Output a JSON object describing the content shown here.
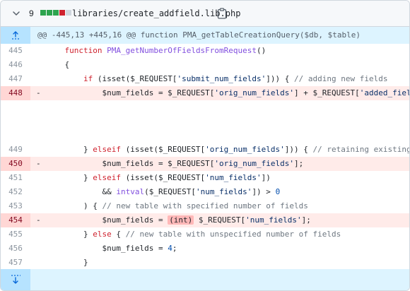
{
  "file": {
    "changes_count": "9",
    "diffstat": [
      "add",
      "add",
      "add",
      "del",
      "neutral"
    ],
    "filename": "libraries/create_addfield.lib.php"
  },
  "hunk": {
    "header": "@@ -445,13 +445,16 @@ function PMA_getTableCreationQuery($db, $table)"
  },
  "lines": [
    {
      "num": "445",
      "type": "ctx",
      "marker": "",
      "tokens": [
        [
          "",
          "    "
        ],
        [
          "k",
          "function "
        ],
        [
          "f",
          "PMA_getNumberOfFieldsFromRequest"
        ],
        [
          "",
          "()"
        ]
      ]
    },
    {
      "num": "446",
      "type": "ctx",
      "marker": "",
      "tokens": [
        [
          "",
          "    {"
        ]
      ]
    },
    {
      "num": "447",
      "type": "ctx",
      "marker": "",
      "tokens": [
        [
          "",
          "        "
        ],
        [
          "k",
          "if "
        ],
        [
          "",
          "(isset($_REQUEST["
        ],
        [
          "s",
          "'submit_num_fields'"
        ],
        [
          "",
          "])) { "
        ],
        [
          "c",
          "// adding new fields"
        ]
      ]
    },
    {
      "num": "448",
      "type": "del",
      "marker": "-",
      "tokens": [
        [
          "",
          "            $num_fields = $_REQUEST["
        ],
        [
          "s",
          "'orig_num_fields'"
        ],
        [
          "",
          "] + $_REQUEST["
        ],
        [
          "s",
          "'added_fields'"
        ],
        [
          "",
          "];"
        ]
      ]
    },
    {
      "num": "",
      "type": "gap",
      "marker": "",
      "tokens": []
    },
    {
      "num": "449",
      "type": "ctx",
      "marker": "",
      "tokens": [
        [
          "",
          "        } "
        ],
        [
          "k",
          "elseif "
        ],
        [
          "",
          "(isset($_REQUEST["
        ],
        [
          "s",
          "'orig_num_fields'"
        ],
        [
          "",
          "])) { "
        ],
        [
          "c",
          "// retaining existing fields"
        ]
      ]
    },
    {
      "num": "450",
      "type": "del",
      "marker": "-",
      "tokens": [
        [
          "",
          "            $num_fields = $_REQUEST["
        ],
        [
          "s",
          "'orig_num_fields'"
        ],
        [
          "",
          "];"
        ]
      ]
    },
    {
      "num": "451",
      "type": "ctx",
      "marker": "",
      "tokens": [
        [
          "",
          "        } "
        ],
        [
          "k",
          "elseif "
        ],
        [
          "",
          "(isset($_REQUEST["
        ],
        [
          "s",
          "'num_fields'"
        ],
        [
          "",
          "])"
        ]
      ]
    },
    {
      "num": "452",
      "type": "ctx",
      "marker": "",
      "tokens": [
        [
          "",
          "            && "
        ],
        [
          "f",
          "intval"
        ],
        [
          "",
          "($_REQUEST["
        ],
        [
          "s",
          "'num_fields'"
        ],
        [
          "",
          "]) > "
        ],
        [
          "n",
          "0"
        ]
      ]
    },
    {
      "num": "453",
      "type": "ctx",
      "marker": "",
      "tokens": [
        [
          "",
          "        ) { "
        ],
        [
          "c",
          "// new table with specified number of fields"
        ]
      ]
    },
    {
      "num": "454",
      "type": "del",
      "marker": "-",
      "tokens": [
        [
          "",
          "            $num_fields = "
        ],
        [
          "hl",
          "(int)"
        ],
        [
          "",
          " $_REQUEST["
        ],
        [
          "s",
          "'num_fields'"
        ],
        [
          "",
          "];"
        ]
      ]
    },
    {
      "num": "455",
      "type": "ctx",
      "marker": "",
      "tokens": [
        [
          "",
          "        } "
        ],
        [
          "k",
          "else "
        ],
        [
          "",
          "{ "
        ],
        [
          "c",
          "// new table with unspecified number of fields"
        ]
      ]
    },
    {
      "num": "456",
      "type": "ctx",
      "marker": "",
      "tokens": [
        [
          "",
          "            $num_fields = "
        ],
        [
          "n",
          "4"
        ],
        [
          "",
          ";"
        ]
      ]
    },
    {
      "num": "457",
      "type": "ctx",
      "marker": "",
      "tokens": [
        [
          "",
          "        }"
        ]
      ]
    }
  ],
  "icons": {
    "collapse": "chevron-down-icon",
    "copy": "copy-icon",
    "expand_up": "expand-up-icon",
    "expand_down": "expand-down-icon"
  },
  "colors": {
    "deletion_bg": "#ffebe9",
    "deletion_gutter": "#ffd7d5",
    "hunk_bg": "#ddf4ff",
    "additions": "#2da44e",
    "deletions": "#cf222e"
  }
}
